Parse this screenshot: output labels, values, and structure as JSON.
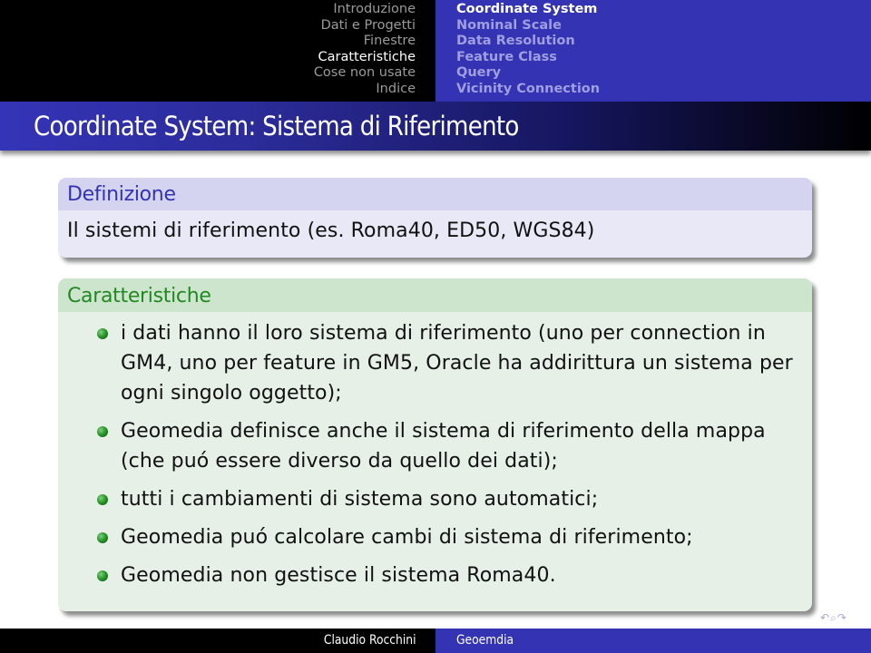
{
  "header": {
    "sections": [
      {
        "label": "Introduzione",
        "active": false
      },
      {
        "label": "Dati e Progetti",
        "active": false
      },
      {
        "label": "Finestre",
        "active": false
      },
      {
        "label": "Caratteristiche",
        "active": true
      },
      {
        "label": "Cose non usate",
        "active": false
      },
      {
        "label": "Indice",
        "active": false
      }
    ],
    "subsections": [
      {
        "label": "Coordinate System",
        "active": true
      },
      {
        "label": "Nominal Scale",
        "active": false
      },
      {
        "label": "Data Resolution",
        "active": false
      },
      {
        "label": "Feature Class",
        "active": false
      },
      {
        "label": "Query",
        "active": false
      },
      {
        "label": "Vicinity Connection",
        "active": false
      }
    ]
  },
  "slide": {
    "title": "Coordinate System: Sistema di Riferimento",
    "definition_block": {
      "title": "Definizione",
      "body": "Il sistemi di riferimento (es. Roma40, ED50, WGS84)"
    },
    "characteristics_block": {
      "title": "Caratteristiche",
      "items": [
        "i dati hanno il loro sistema di riferimento (uno per connection in GM4, uno per feature in GM5, Oracle ha addirittura un sistema per ogni singolo oggetto);",
        "Geomedia definisce anche il sistema di riferimento della mappa (che puó essere diverso da quello dei dati);",
        "tutti i cambiamenti di sistema sono automatici;",
        "Geomedia puó calcolare cambi di sistema di riferimento;",
        "Geomedia non gestisce il sistema Roma40."
      ]
    }
  },
  "footer": {
    "author": "Claudio Rocchini",
    "short_title": "Geoemdia"
  },
  "nav_symbols": {
    "back": "↶",
    "search": "⌕",
    "forward": "↷"
  },
  "colors": {
    "header_left_bg": "#000000",
    "header_right_bg": "#3333b3",
    "definition_title": "#3333b3",
    "characteristics_title": "#228822",
    "bullet": "#2a9a2a"
  }
}
